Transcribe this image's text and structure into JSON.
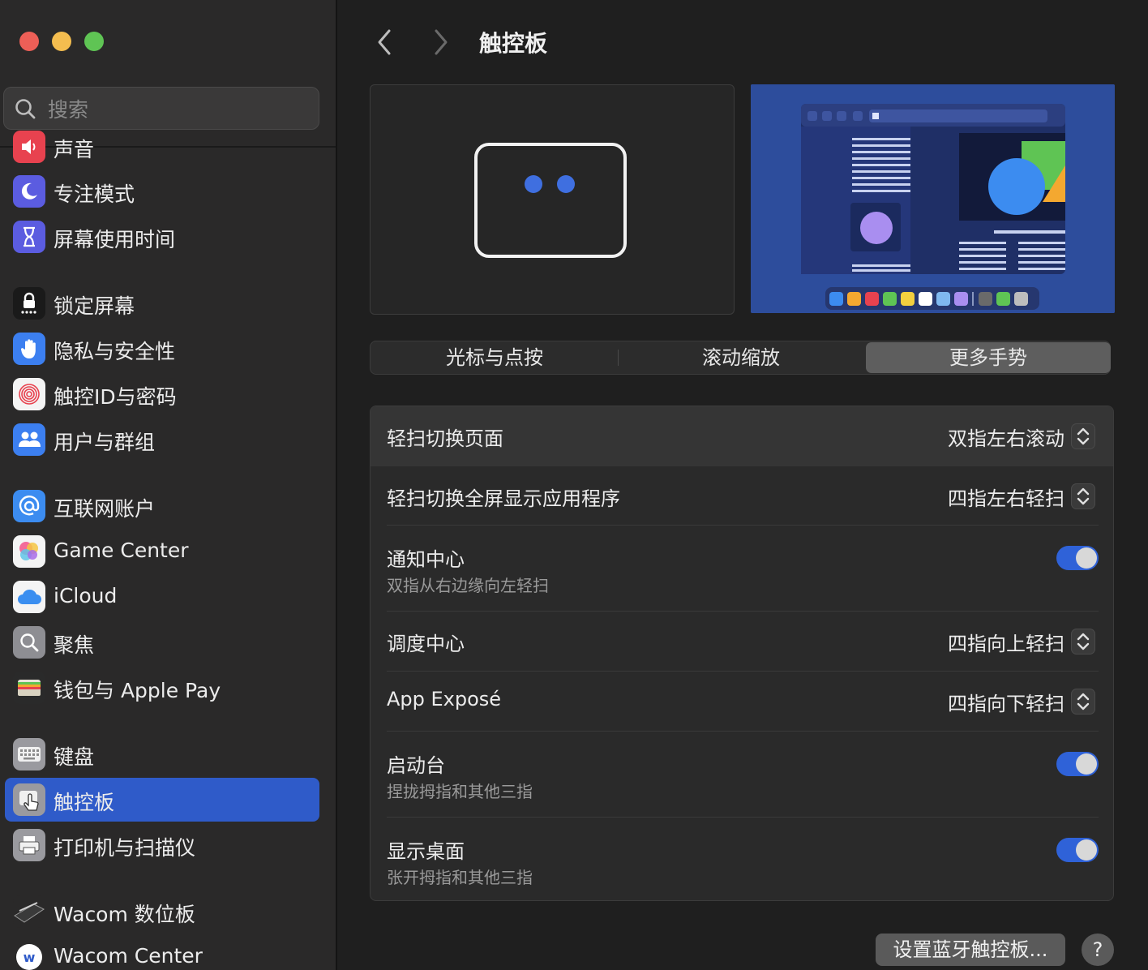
{
  "window": {
    "traffic_lights": {
      "close_color": "#ed5f57",
      "minimize_color": "#f4bd4f",
      "zoom_color": "#5fc454"
    }
  },
  "sidebar": {
    "search_placeholder": "搜索",
    "items": [
      {
        "label": "声音",
        "icon": "speaker-icon",
        "color": "#e8424f"
      },
      {
        "label": "专注模式",
        "icon": "moon-icon",
        "color": "#5b5ce0"
      },
      {
        "label": "屏幕使用时间",
        "icon": "hourglass-icon",
        "color": "#5b5ce0"
      },
      {
        "label": "锁定屏幕",
        "icon": "lock-icon",
        "color": "#1a1a1a"
      },
      {
        "label": "隐私与安全性",
        "icon": "hand-icon",
        "color": "#3c7ff0"
      },
      {
        "label": "触控ID与密码",
        "icon": "fingerprint-icon",
        "color": "#f4f4f4"
      },
      {
        "label": "用户与群组",
        "icon": "users-icon",
        "color": "#3c7ff0"
      },
      {
        "label": "互联网账户",
        "icon": "at-icon",
        "color": "#3c8cf0"
      },
      {
        "label": "Game Center",
        "icon": "game-center-icon",
        "color": "#f4f4f4"
      },
      {
        "label": "iCloud",
        "icon": "cloud-icon",
        "color": "#f4f4f4"
      },
      {
        "label": "聚焦",
        "icon": "magnifier-icon",
        "color": "#8e8e93"
      },
      {
        "label": "钱包与 Apple Pay",
        "icon": "wallet-icon",
        "color": "#2a2a2a"
      },
      {
        "label": "键盘",
        "icon": "keyboard-icon",
        "color": "#9a9a9f"
      },
      {
        "label": "触控板",
        "icon": "trackpad-icon",
        "color": "#9a9a9f",
        "selected": true
      },
      {
        "label": "打印机与扫描仪",
        "icon": "printer-icon",
        "color": "#9a9a9f"
      },
      {
        "label": "Wacom 数位板",
        "icon": "tablet-pen-icon",
        "color": "#2a2929"
      },
      {
        "label": "Wacom Center",
        "icon": "wacom-icon",
        "color": "#f4f4f4"
      }
    ]
  },
  "toolbar": {
    "title": "触控板"
  },
  "tabs": [
    {
      "label": "光标与点按",
      "active": false
    },
    {
      "label": "滚动缩放",
      "active": false
    },
    {
      "label": "更多手势",
      "active": true
    }
  ],
  "settings": [
    {
      "label": "轻扫切换页面",
      "value": "双指左右滚动",
      "type": "popup"
    },
    {
      "label": "轻扫切换全屏显示应用程序",
      "value": "四指左右轻扫",
      "type": "popup"
    },
    {
      "label": "通知中心",
      "sub": "双指从右边缘向左轻扫",
      "type": "toggle",
      "on": true
    },
    {
      "label": "调度中心",
      "value": "四指向上轻扫",
      "type": "popup"
    },
    {
      "label": "App Exposé",
      "value": "四指向下轻扫",
      "type": "popup"
    },
    {
      "label": "启动台",
      "sub": "捏拢拇指和其他三指",
      "type": "toggle",
      "on": true
    },
    {
      "label": "显示桌面",
      "sub": "张开拇指和其他三指",
      "type": "toggle",
      "on": true
    }
  ],
  "footer": {
    "bluetooth_button": "设置蓝牙触控板...",
    "help_button": "?"
  },
  "colors": {
    "accent": "#2f62d8",
    "selection": "#2f5bc9"
  }
}
